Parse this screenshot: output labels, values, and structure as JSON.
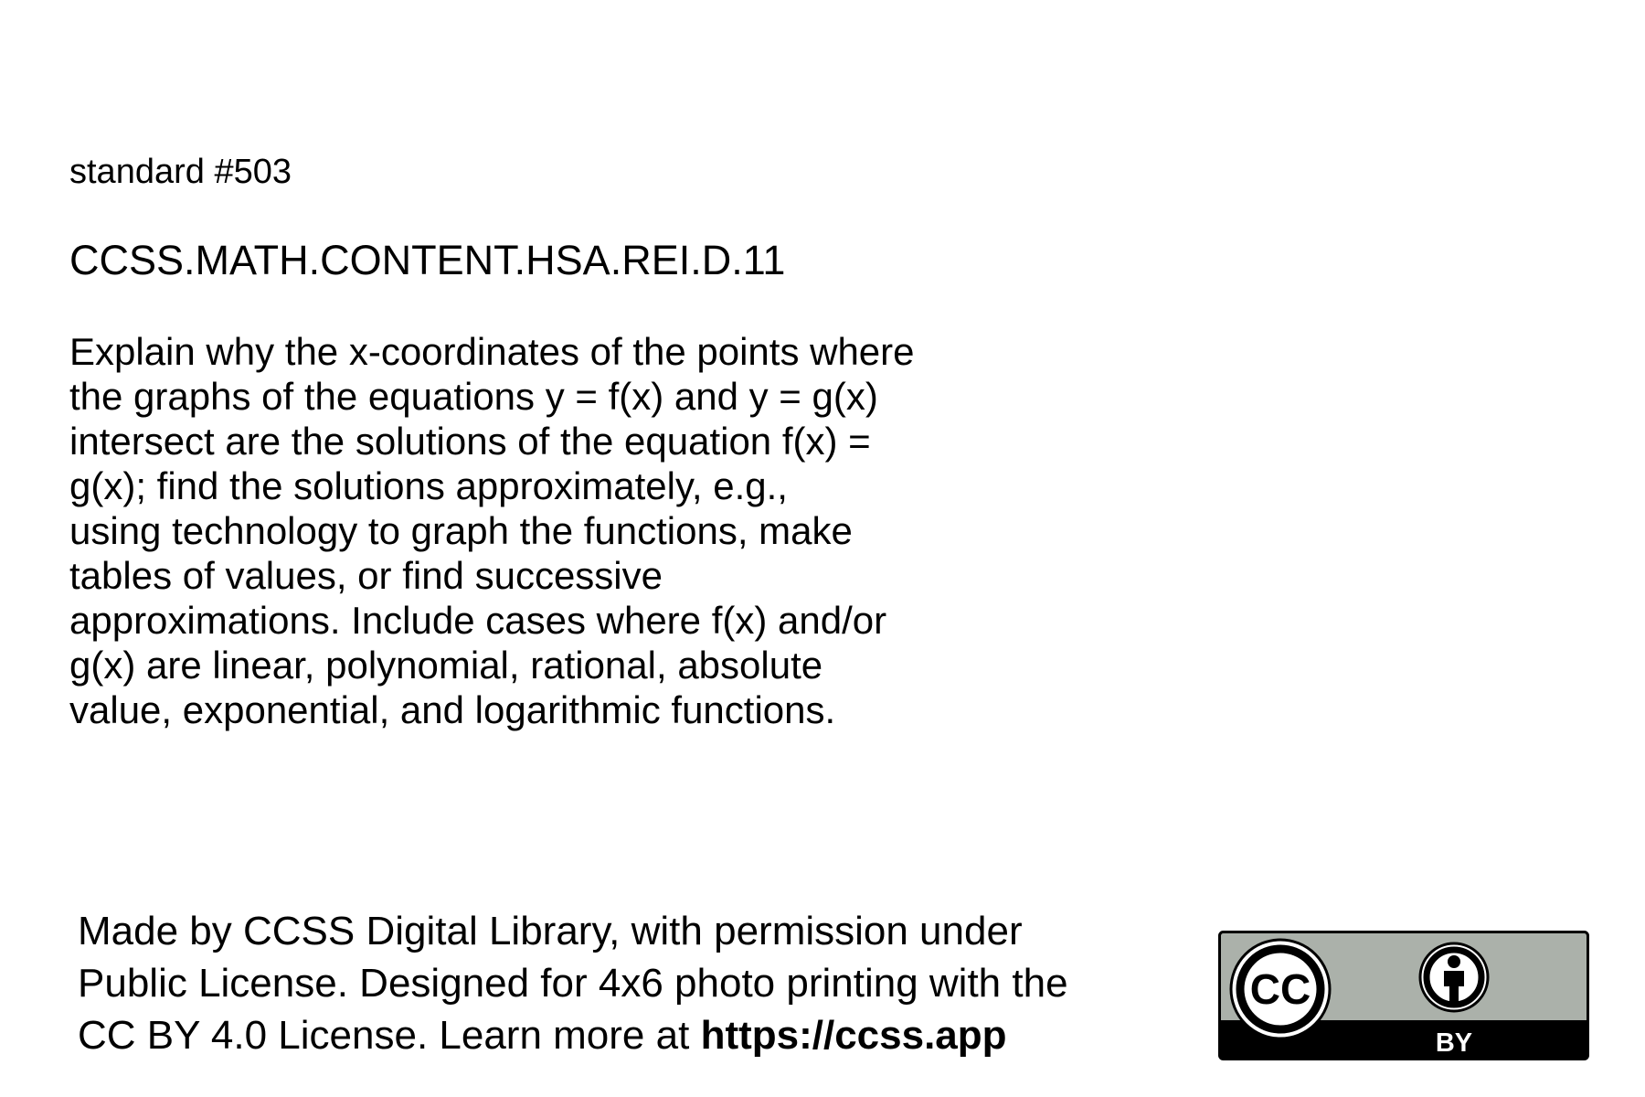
{
  "standard": {
    "number_label": "standard #503",
    "code": "CCSS.MATH.CONTENT.HSA.REI.D.11",
    "description_lines": [
      "Explain why the x-coordinates of the points where",
      "the graphs of the equations y = f(x) and y = g(x)",
      "intersect are the solutions of the equation f(x) =",
      "g(x); find the solutions approximately, e.g.,",
      "using technology to graph the functions, make",
      "tables of values, or find successive",
      "approximations. Include cases where f(x) and/or",
      "g(x) are linear, polynomial, rational, absolute",
      "value, exponential, and logarithmic functions."
    ]
  },
  "footer": {
    "line1": "Made by CCSS Digital Library, with permission under",
    "line2": "Public License. Designed for 4x6 photo printing with the",
    "line3_prefix": "CC BY 4.0 License. Learn more at ",
    "url": "https://ccss.app"
  },
  "license_badge": {
    "cc_text": "CC",
    "by_text": "BY",
    "icon": "cc-by-license-icon",
    "colors": {
      "badge_gray": "#abb1aa",
      "badge_black": "#000000",
      "badge_white": "#ffffff"
    }
  }
}
